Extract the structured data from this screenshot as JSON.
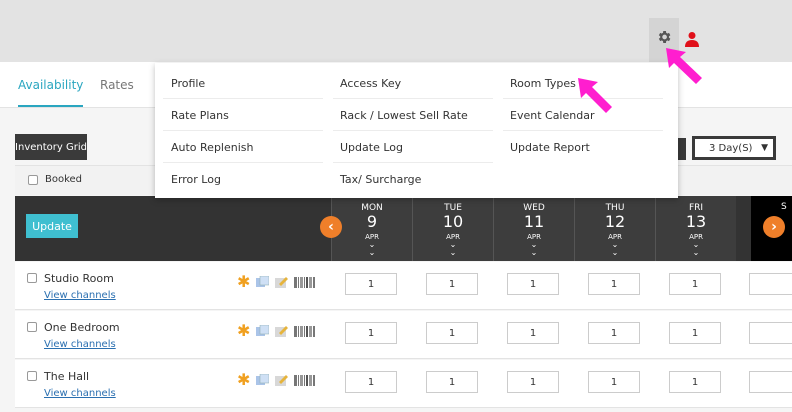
{
  "tabs": [
    {
      "label": "Availability",
      "active": true
    },
    {
      "label": "Rates",
      "active": false
    }
  ],
  "toolbar": {
    "inventory_grid_label": "Inventory Grid",
    "days_selected": "3 Day(S)"
  },
  "grid": {
    "booked_label": "Booked",
    "update_label": "Update",
    "days": [
      {
        "name": "MON",
        "num": "9",
        "month": "APR"
      },
      {
        "name": "TUE",
        "num": "10",
        "month": "APR"
      },
      {
        "name": "WED",
        "num": "11",
        "month": "APR"
      },
      {
        "name": "THU",
        "num": "12",
        "month": "APR"
      },
      {
        "name": "FRI",
        "num": "13",
        "month": "APR"
      }
    ],
    "next_day_partial": "S",
    "rooms": [
      {
        "name": "Studio Room",
        "link": "View channels",
        "values": [
          "1",
          "1",
          "1",
          "1",
          "1"
        ]
      },
      {
        "name": "One Bedroom",
        "link": "View channels",
        "values": [
          "1",
          "1",
          "1",
          "1",
          "1"
        ]
      },
      {
        "name": "The Hall",
        "link": "View channels",
        "values": [
          "1",
          "1",
          "1",
          "1",
          "1"
        ]
      }
    ]
  },
  "settings_menu": {
    "col1": [
      "Profile",
      "Rate Plans",
      "Auto Replenish",
      "Error Log"
    ],
    "col2": [
      "Access Key",
      "Rack / Lowest Sell Rate",
      "Update Log",
      "Tax/ Surcharge"
    ],
    "col3": [
      "Room Types",
      "Event Calendar",
      "Update Report"
    ]
  },
  "icons": {
    "gear": "gear-icon",
    "user": "user-icon",
    "star": "star-icon",
    "copy": "copy-icon",
    "edit": "edit-icon",
    "barcode": "barcode-icon",
    "prev": "chevron-left-icon",
    "next": "chevron-right-icon"
  },
  "colors": {
    "accent": "#2aa6c0",
    "update": "#3fbfd0",
    "nav_arrow": "#ef7f2a",
    "user_icon": "#e0101a",
    "pointer_arrow": "#ff1ecf",
    "header_bg": "#333333"
  }
}
